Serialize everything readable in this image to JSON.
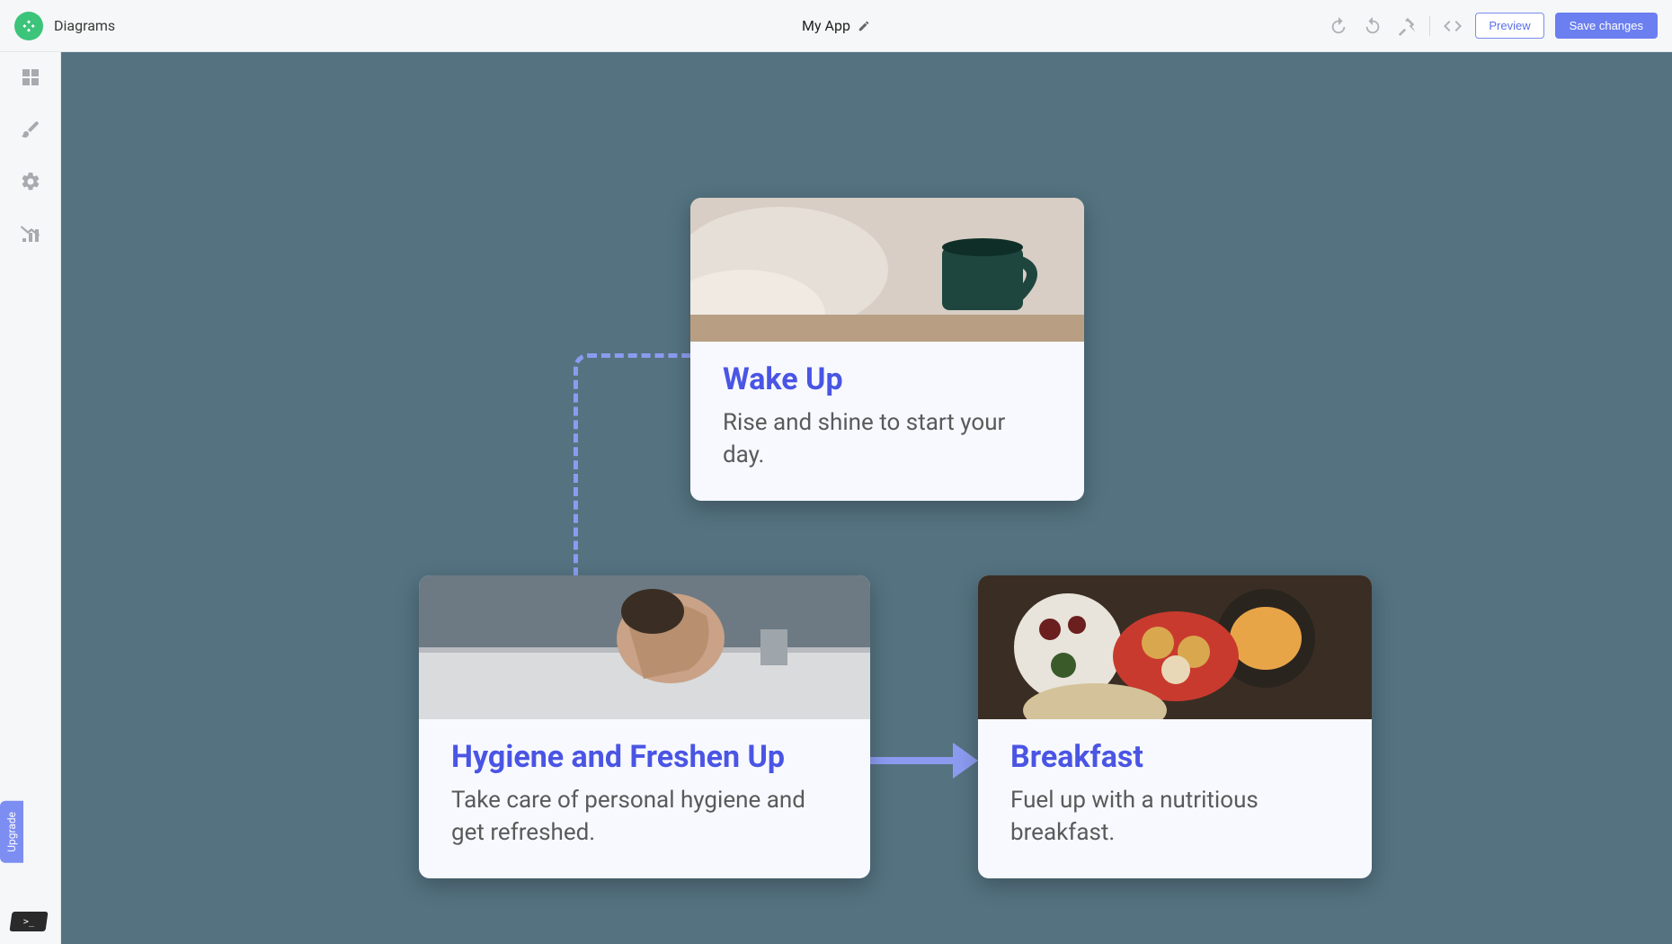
{
  "header": {
    "breadcrumb": "Diagrams",
    "title": "My App",
    "preview": "Preview",
    "save": "Save changes"
  },
  "sidebar": {
    "upgrade": "Upgrade"
  },
  "cards": [
    {
      "title": "Wake Up",
      "subtitle": "Rise and shine to start your day."
    },
    {
      "title": "Hygiene and Freshen Up",
      "subtitle": "Take care of personal hygiene and get refreshed."
    },
    {
      "title": "Breakfast",
      "subtitle": "Fuel up with a nutritious breakfast."
    }
  ],
  "colors": {
    "accent": "#4a55e4",
    "connector": "#8c9bf0",
    "canvas": "#547280"
  }
}
